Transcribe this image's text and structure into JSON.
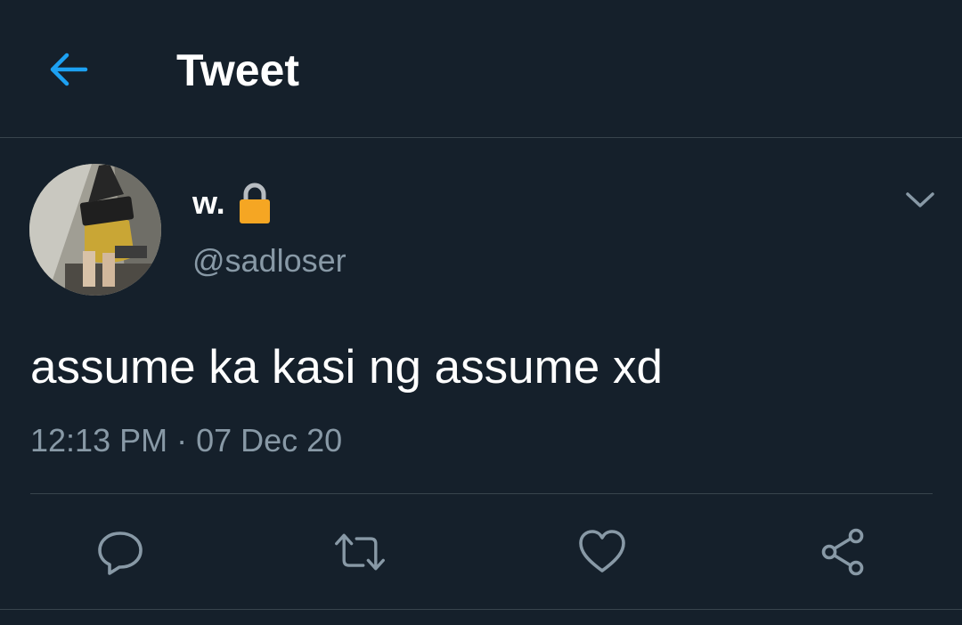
{
  "header": {
    "title": "Tweet",
    "back_icon": "arrow-left-icon",
    "accent_color": "#1da1f2"
  },
  "author": {
    "display_name": "w.",
    "handle": "@sadloser",
    "protected_icon": "lock-icon",
    "avatar": "profile-photo"
  },
  "tweet": {
    "text": "assume ka kasi ng assume xd",
    "meta": "12:13 PM · 07 Dec 20"
  },
  "actions": [
    {
      "icon": "reply-icon"
    },
    {
      "icon": "retweet-icon"
    },
    {
      "icon": "like-icon"
    },
    {
      "icon": "share-icon"
    }
  ],
  "colors": {
    "background": "#15202b",
    "secondary_text": "#8899a6",
    "border": "#38444d",
    "lock": "#f5a623"
  }
}
